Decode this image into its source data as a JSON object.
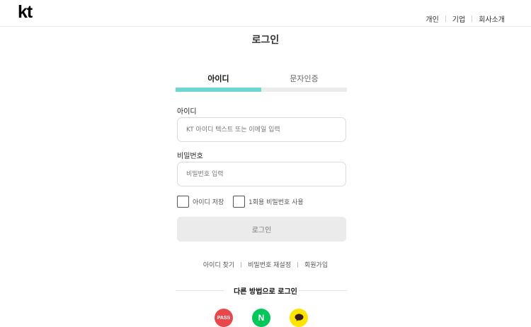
{
  "header": {
    "logo_text": "kt",
    "nav": [
      {
        "label": "개인"
      },
      {
        "label": "기업"
      },
      {
        "label": "회사소개"
      }
    ]
  },
  "page": {
    "title": "로그인"
  },
  "tabs": [
    {
      "label": "아이디",
      "active": true
    },
    {
      "label": "문자인증",
      "active": false
    }
  ],
  "form": {
    "id_label": "아이디",
    "id_placeholder": "KT 아이디 텍스트 또는 이메일 입력",
    "id_value": "",
    "password_label": "비밀번호",
    "password_placeholder": "비밀번호 입력",
    "password_value": "",
    "save_id_label": "아이디 저장",
    "save_id_checked": false,
    "otp_label": "1회용 비밀번호 사용",
    "otp_checked": false,
    "submit_label": "로그인"
  },
  "links": [
    {
      "label": "아이디 찾기"
    },
    {
      "label": "비밀번호 재설정"
    },
    {
      "label": "회원가입"
    }
  ],
  "alt_login": {
    "title": "다른 방법으로 로그인",
    "providers": [
      {
        "name": "PASS",
        "icon": "pass-icon",
        "color": "#e8474c"
      },
      {
        "name": "N",
        "icon": "naver-icon",
        "color": "#03c75a"
      },
      {
        "name": "",
        "icon": "kakao-icon",
        "color": "#fee500"
      }
    ]
  },
  "colors": {
    "accent": "#6dd6d2",
    "button_bg": "#ebebeb",
    "button_text": "#777777"
  }
}
